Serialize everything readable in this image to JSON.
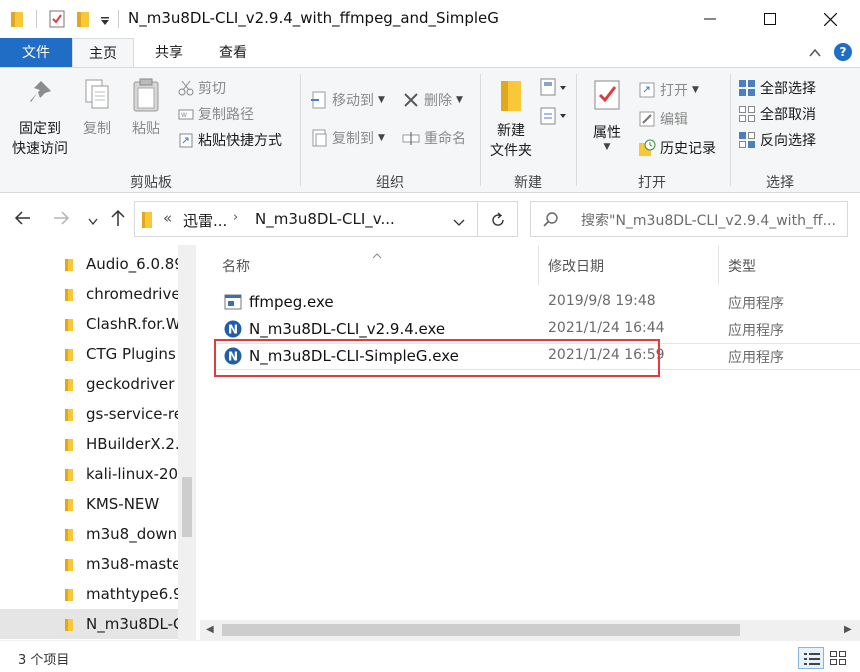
{
  "window": {
    "title": "N_m3u8DL-CLI_v2.9.4_with_ffmpeg_and_SimpleG",
    "controls": [
      "minimize",
      "maximize",
      "close"
    ]
  },
  "ribbon_tabs": [
    {
      "label": "文件",
      "active": false
    },
    {
      "label": "主页",
      "active": true
    },
    {
      "label": "共享",
      "active": false
    },
    {
      "label": "查看",
      "active": false
    }
  ],
  "ribbon": {
    "clipboard": {
      "label": "剪贴板",
      "pin_line1": "固定到",
      "pin_line2": "快速访问",
      "copy": "复制",
      "paste": "粘贴",
      "cut": "剪切",
      "copy_path": "复制路径",
      "paste_shortcut": "粘贴快捷方式"
    },
    "organize": {
      "label": "组织",
      "move_to": "移动到",
      "copy_to": "复制到",
      "delete": "删除",
      "rename": "重命名"
    },
    "new": {
      "label": "新建",
      "new_folder_line1": "新建",
      "new_folder_line2": "文件夹"
    },
    "open": {
      "label": "打开",
      "properties": "属性",
      "open": "打开",
      "edit": "编辑",
      "history": "历史记录"
    },
    "select": {
      "label": "选择",
      "select_all": "全部选择",
      "select_none": "全部取消",
      "invert": "反向选择"
    }
  },
  "address": {
    "overflow": "«",
    "crumbs": [
      "迅雷...",
      "N_m3u8DL-CLI_v..."
    ],
    "search_placeholder": "搜索\"N_m3u8DL-CLI_v2.9.4_with_ff..."
  },
  "nav_items": [
    "Audio_6.0.89",
    "chromedrive",
    "ClashR.for.W",
    "CTG Plugins",
    "geckodriver",
    "gs-service-re",
    "HBuilderX.2.",
    "kali-linux-20",
    "KMS-NEW",
    "m3u8_down",
    "m3u8-maste",
    "mathtype6.9",
    "N_m3u8DL-C"
  ],
  "columns": {
    "name": "名称",
    "date": "修改日期",
    "type": "类型"
  },
  "files": [
    {
      "name": "ffmpeg.exe",
      "date": "2019/9/8 19:48",
      "type": "应用程序",
      "icon": "exe-window-icon"
    },
    {
      "name": "N_m3u8DL-CLI_v2.9.4.exe",
      "date": "2021/1/24 16:44",
      "type": "应用程序",
      "icon": "n-logo-icon"
    },
    {
      "name": "N_m3u8DL-CLI-SimpleG.exe",
      "date": "2021/1/24 16:59",
      "type": "应用程序",
      "icon": "n-logo-icon",
      "highlighted": true
    }
  ],
  "status": {
    "count_text": "3 个项目"
  },
  "colors": {
    "accent": "#1f6dc4",
    "highlight": "#e43a3a",
    "folder": "#f8c838"
  }
}
